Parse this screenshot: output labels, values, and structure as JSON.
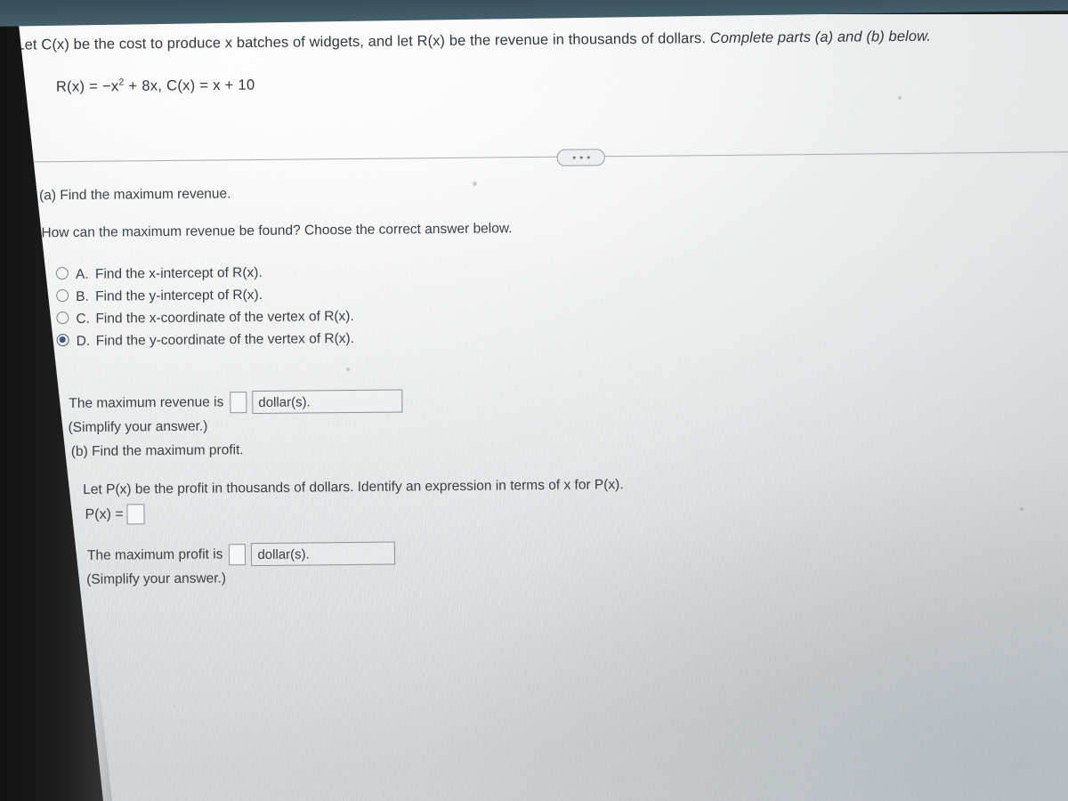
{
  "question": {
    "stem_prefix": "Let C(x) be the cost to produce x batches of widgets, and let R(x) be the revenue in thousands of dollars. ",
    "stem_italic": "Complete parts (a) and (b) below.",
    "formula_r_label": "R(x) = −x",
    "formula_exponent": "2",
    "formula_r_rest": " + 8x,",
    "formula_c": "C(x) = x + 10"
  },
  "divider": {
    "ellipsis_label": "..."
  },
  "part_a": {
    "heading": "(a) Find the maximum revenue.",
    "prompt": "How can the maximum revenue be found? Choose the correct answer below.",
    "choices": [
      {
        "letter": "A.",
        "text": "Find the x-intercept of R(x).",
        "selected": false
      },
      {
        "letter": "B.",
        "text": "Find the y-intercept of R(x).",
        "selected": false
      },
      {
        "letter": "C.",
        "text": "Find the x-coordinate of the vertex of R(x).",
        "selected": false
      },
      {
        "letter": "D.",
        "text": "Find the y-coordinate of the vertex of R(x).",
        "selected": true
      }
    ],
    "answer_label": "The maximum revenue is",
    "answer_value": "",
    "answer_placeholder": "",
    "unit_text": "dollar(s).",
    "simplify_note": "(Simplify your answer.)"
  },
  "part_b": {
    "heading": "(b) Find the maximum profit.",
    "prompt": "Let P(x) be the profit in thousands of dollars. Identify an expression in terms of x for P(x).",
    "px_label": "P(x) =",
    "px_value": "",
    "px_placeholder": "",
    "answer_label": "The maximum profit is",
    "answer_value": "",
    "answer_placeholder": "",
    "unit_text": "dollar(s).",
    "simplify_note": "(Simplify your answer.)"
  },
  "colors": {
    "text": "#3b4046",
    "radio_selected": "#42567a",
    "box_border": "#8b9298",
    "divider": "#9aa0a4",
    "screen_bg": "#eceeef",
    "bezel_top": "#3a525c"
  }
}
